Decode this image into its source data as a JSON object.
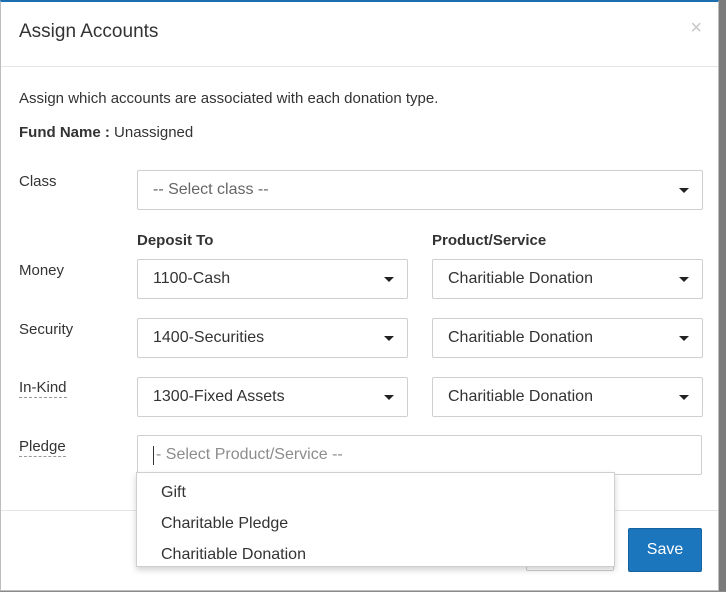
{
  "modal": {
    "title": "Assign Accounts",
    "close_symbol": "×",
    "intro": "Assign which accounts are associated with each donation type.",
    "fund_label": "Fund Name :",
    "fund_value": "Unassigned"
  },
  "class_row": {
    "label": "Class",
    "value": "-- Select class --"
  },
  "columns": {
    "deposit_to": "Deposit To",
    "product_service": "Product/Service"
  },
  "rows": [
    {
      "label": "Money",
      "deposit": "1100-Cash",
      "product": "Charitiable Donation"
    },
    {
      "label": "Security",
      "deposit": "1400-Securities",
      "product": "Charitiable Donation"
    },
    {
      "label": "In-Kind",
      "deposit": "1300-Fixed Assets",
      "product": "Charitiable Donation"
    }
  ],
  "pledge": {
    "label": "Pledge",
    "placeholder": "- Select Product/Service --",
    "options": [
      "Gift",
      "Charitable Pledge",
      "Charitiable Donation"
    ]
  },
  "footer": {
    "save_label": "Save"
  },
  "icons": {
    "caret": "chevron-down-icon",
    "close": "close-icon"
  },
  "colors": {
    "accent": "#1c76bd",
    "header_border": "#1b6fb0"
  }
}
